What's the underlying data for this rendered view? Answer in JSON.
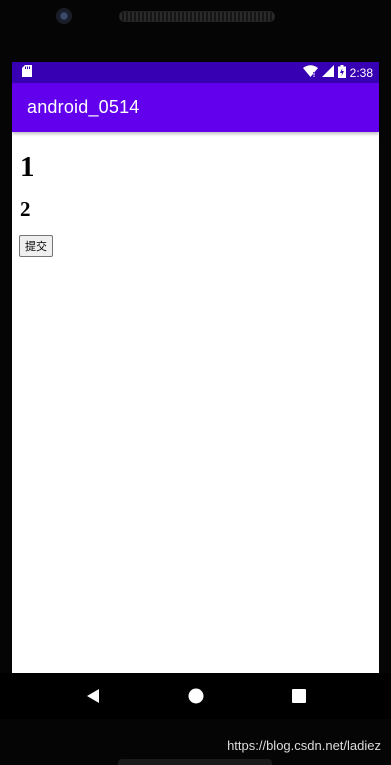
{
  "status_bar": {
    "time": "2:38",
    "icons": [
      "sd-card-icon",
      "wifi-icon",
      "signal-icon",
      "battery-icon"
    ]
  },
  "app_bar": {
    "title": "android_0514"
  },
  "content": {
    "heading1": "1",
    "heading2": "2",
    "submit_label": "提交"
  },
  "nav_bar": {
    "buttons": [
      "back-icon",
      "home-icon",
      "recents-icon"
    ]
  },
  "watermark": "https://blog.csdn.net/ladiez",
  "colors": {
    "status_bar": "#3700b3",
    "app_bar": "#6200ee",
    "screen_bg": "#ffffff",
    "device_frame": "#050505"
  }
}
